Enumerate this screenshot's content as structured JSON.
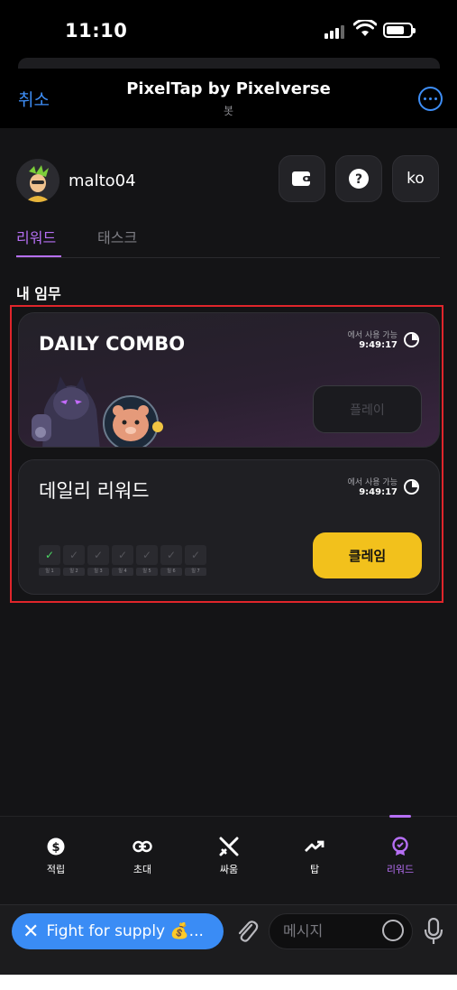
{
  "status_bar": {
    "time": "11:10"
  },
  "header": {
    "cancel": "취소",
    "title": "PixelTap by Pixelverse",
    "subtitle": "봇"
  },
  "user": {
    "name": "malto04",
    "lang": "ko"
  },
  "tabs": [
    {
      "label": "리워드",
      "active": true
    },
    {
      "label": "태스크",
      "active": false
    }
  ],
  "section_title": "내 임무",
  "daily_combo": {
    "title": "DAILY COMBO",
    "available_label": "에서 사용 가능",
    "time": "9:49:17",
    "button": "플레이"
  },
  "daily_reward": {
    "title": "데일리 리워드",
    "available_label": "에서 사용 가능",
    "time": "9:49:17",
    "button": "클레임",
    "days": [
      {
        "label": "일 1",
        "done": true
      },
      {
        "label": "일 2",
        "done": false
      },
      {
        "label": "일 3",
        "done": false
      },
      {
        "label": "일 4",
        "done": false
      },
      {
        "label": "일 5",
        "done": false
      },
      {
        "label": "일 6",
        "done": false
      },
      {
        "label": "일 7",
        "done": false
      }
    ]
  },
  "nav": [
    {
      "label": "적립",
      "icon": "dollar-coin-icon"
    },
    {
      "label": "초대",
      "icon": "link-icon"
    },
    {
      "label": "싸움",
      "icon": "swords-icon"
    },
    {
      "label": "탑",
      "icon": "trending-up-icon"
    },
    {
      "label": "리워드",
      "icon": "badge-icon",
      "active": true
    }
  ],
  "input_bar": {
    "pill_text": "Fight for supply 💰...",
    "placeholder": "메시지"
  },
  "colors": {
    "accent": "#b66ff4",
    "telegram_blue": "#3e8ef7",
    "claim_yellow": "#f2c11c",
    "highlight_red": "#e0252b"
  }
}
